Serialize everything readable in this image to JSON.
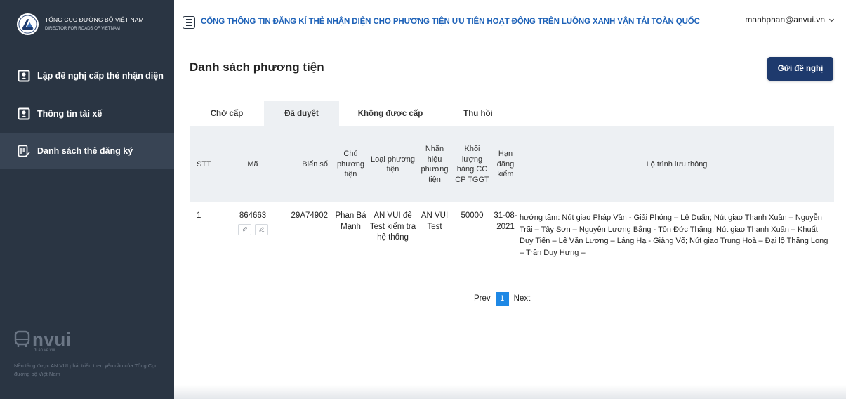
{
  "brand": {
    "line1": "TỔNG CỤC ĐƯỜNG BỘ VIỆT NAM",
    "line2": "DIRECTOR FOR ROADS OF VIETNAM",
    "logo_text": "DRVN"
  },
  "sidebar": {
    "items": [
      {
        "label": "Lập đề nghị cấp thẻ nhận diện",
        "icon": "contact-card-icon"
      },
      {
        "label": "Thông tin tài xế",
        "icon": "contact-card-icon"
      },
      {
        "label": "Danh sách thẻ đăng ký",
        "icon": "list-document-icon"
      }
    ],
    "footer_logo_text": "nvui",
    "footer_tagline": "đi an về vui",
    "footer_note": "Nền tảng được AN VUI phát triển theo yêu cầu của Tổng Cục đường bộ Việt Nam"
  },
  "header": {
    "title": "CỔNG THÔNG TIN ĐĂNG KÍ THẺ NHẬN DIỆN CHO PHƯƠNG TIỆN ƯU TIÊN HOẠT ĐỘNG TRÊN LUỒNG XANH VẬN TẢI TOÀN QUỐC",
    "user_email": "manhphan@anvui.vn"
  },
  "main": {
    "page_title": "Danh sách phương tiện",
    "send_button": "Gửi đề nghị",
    "tabs": [
      {
        "label": "Chờ cấp",
        "active": false
      },
      {
        "label": "Đã duyệt",
        "active": true
      },
      {
        "label": "Không được cấp",
        "active": false
      },
      {
        "label": "Thu hồi",
        "active": false
      }
    ],
    "table": {
      "headers": {
        "stt": "STT",
        "code": "Mã",
        "plate": "Biển số",
        "owner": "Chủ phương tiện",
        "type": "Loại phương tiện",
        "brand": "Nhãn hiệu phương tiện",
        "load": "Khối lượng hàng CC CP TGGT",
        "inspection": "Hạn đăng kiểm",
        "route": "Lộ trình lưu thông"
      },
      "rows": [
        {
          "stt": "1",
          "code": "864663",
          "plate": "29A74902",
          "owner": "Phan Bá Mạnh",
          "type": "AN VUI để Test kiểm tra hệ thống",
          "brand": "AN VUI Test",
          "load": "50000",
          "inspection": "31-08-2021",
          "route": "hướng tâm: Nút giao Pháp Vân - Giải Phóng – Lê Duẩn; Nút giao Thanh Xuân – Nguyễn Trãi – Tây Sơn – Nguyễn Lương Bằng - Tôn Đức Thắng; Nút giao Thanh Xuân – Khuất Duy Tiến – Lê Văn Lương – Láng Hạ - Giảng Võ; Nút giao Trung Hoà – Đại lộ Thăng Long – Trần Duy Hưng –"
        }
      ]
    },
    "pagination": {
      "prev": "Prev",
      "current": "1",
      "next": "Next"
    }
  },
  "colors": {
    "sidebar_bg": "#2a3543",
    "sidebar_active": "#384454",
    "header_title": "#1e62b8",
    "primary_button": "#1e3a6d",
    "page_active": "#1e88e5",
    "table_header_bg": "#edf0f3"
  }
}
